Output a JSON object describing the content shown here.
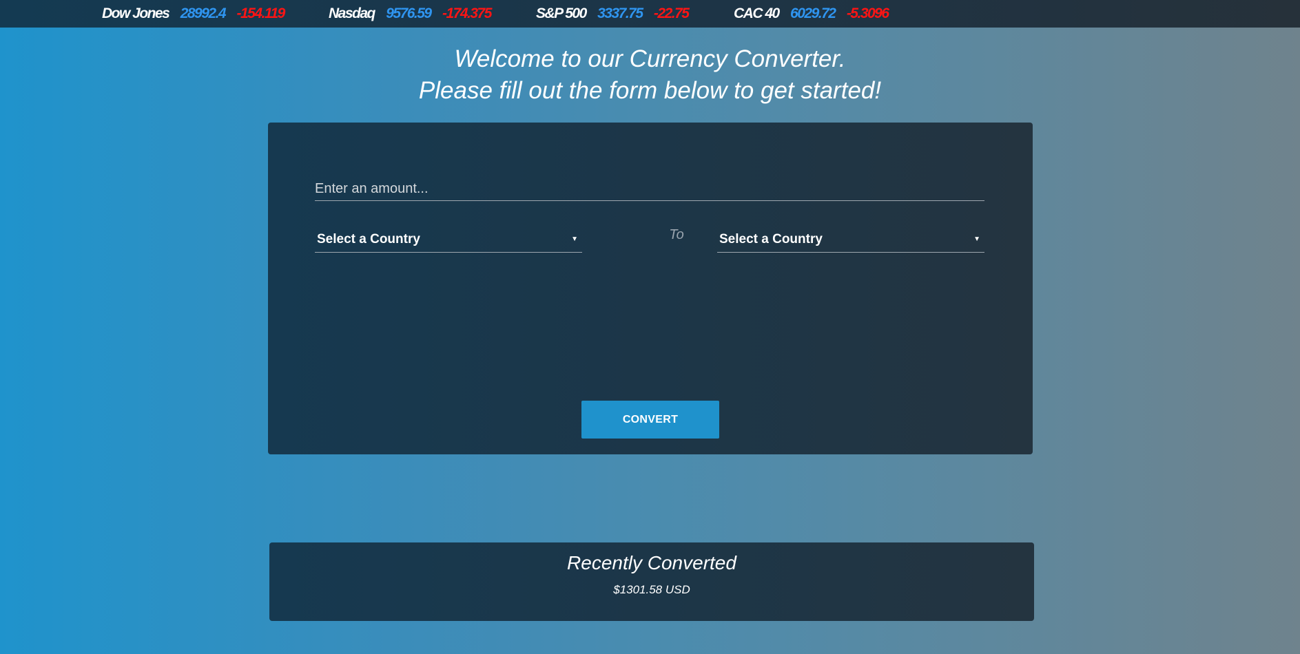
{
  "ticker": [
    {
      "name": "Dow Jones",
      "value": "28992.4",
      "change": "-154.119"
    },
    {
      "name": "Nasdaq",
      "value": "9576.59",
      "change": "-174.375"
    },
    {
      "name": "S&P 500",
      "value": "3337.75",
      "change": "-22.75"
    },
    {
      "name": "CAC 40",
      "value": "6029.72",
      "change": "-5.3096"
    }
  ],
  "heading": {
    "line1": "Welcome to our Currency Converter.",
    "line2": "Please fill out the form below to get started!"
  },
  "converter": {
    "amount_placeholder": "Enter an amount...",
    "amount_value": "",
    "from_select": "Select a Country",
    "to_label": "To",
    "to_select": "Select a Country",
    "convert_label": "CONVERT"
  },
  "recent": {
    "title": "Recently Converted",
    "value": "$1301.58 USD"
  },
  "colors": {
    "ticker_value": "#2f95f0",
    "ticker_change": "#ff1414",
    "button": "#1f92cc",
    "panel": "#1c3648"
  }
}
